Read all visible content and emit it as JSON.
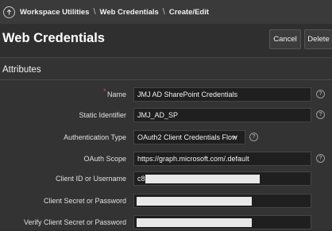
{
  "breadcrumb": {
    "items": [
      "Workspace Utilities",
      "Web Credentials",
      "Create/Edit"
    ],
    "separator": "\\"
  },
  "header": {
    "title": "Web Credentials",
    "cancel_label": "Cancel",
    "delete_label": "Delete"
  },
  "region": {
    "title": "Attributes"
  },
  "form": {
    "name": {
      "label": "Name",
      "value": "JMJ AD SharePoint Credentials",
      "required": true
    },
    "static_identifier": {
      "label": "Static Identifier",
      "value": "JMJ_AD_SP"
    },
    "authentication_type": {
      "label": "Authentication Type",
      "value": "OAuth2 Client Credentials Flow"
    },
    "oauth_scope": {
      "label": "OAuth Scope",
      "value": "https://graph.microsoft.com/.default"
    },
    "client_id": {
      "label": "Client ID or Username",
      "value": "c8"
    },
    "client_secret": {
      "label": "Client Secret or Password",
      "value": ""
    },
    "verify_secret": {
      "label": "Verify Client Secret or Password",
      "value": ""
    }
  },
  "colors": {
    "background": "#2b2b2b",
    "breadcrumb_bar": "#3a3a3a",
    "required_marker": "#e05050"
  },
  "icons": {
    "home": "up-arrow-circle-icon",
    "help": "question-circle-icon",
    "select_caret": "chevron-down-icon"
  }
}
